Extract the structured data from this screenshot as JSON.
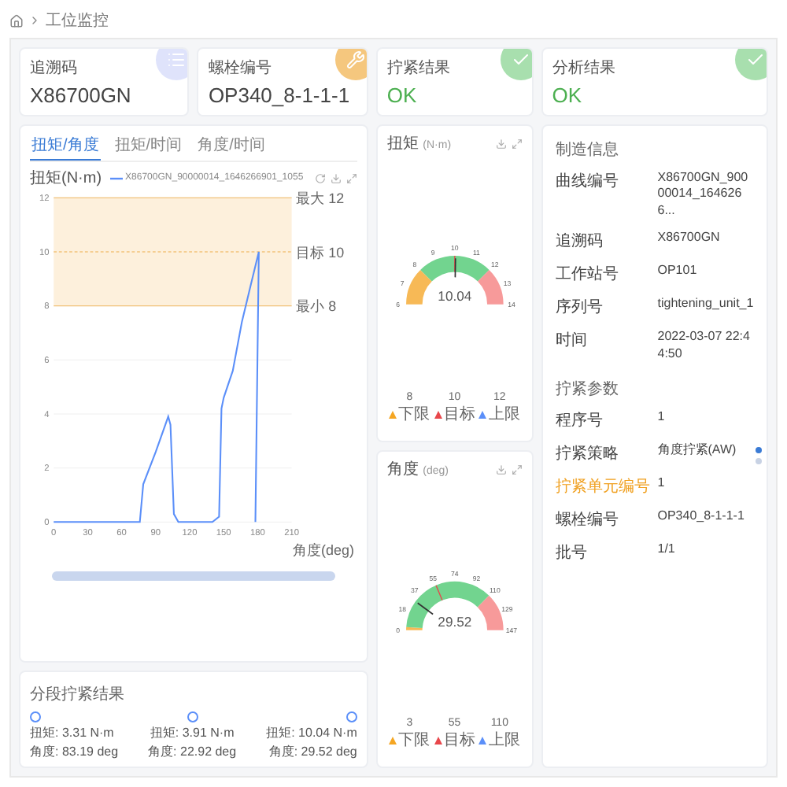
{
  "breadcrumb": {
    "items": [
      "工位监控"
    ]
  },
  "summary_cards": [
    {
      "kind": "code",
      "label": "追溯码",
      "value": "X86700GN"
    },
    {
      "kind": "bolt",
      "label": "螺栓编号",
      "value": "OP340_8-1-1-1"
    },
    {
      "kind": "ok",
      "label": "拧紧结果",
      "value": "OK"
    },
    {
      "kind": "ok",
      "label": "分析结果",
      "value": "OK"
    }
  ],
  "curve_chart": {
    "tabs": [
      {
        "label": "扭矩/角度",
        "selected": true
      },
      {
        "label": "扭矩/时间",
        "selected": false
      },
      {
        "label": "角度/时间",
        "selected": false
      }
    ],
    "chart_data": {
      "type": "line",
      "ylabel": "扭矩(N·m)",
      "xlabel": "角度(deg)",
      "x": [
        0,
        30,
        60,
        76,
        79,
        90,
        101,
        103,
        106,
        110,
        140,
        146,
        148,
        150,
        158,
        166,
        174,
        181,
        178
      ],
      "series": [
        {
          "name": "X86700GN_90000014_1646266901_1055",
          "color": "#5b8ff9",
          "values": [
            0,
            0,
            0,
            0,
            1.4,
            2.6,
            3.9,
            3.6,
            0.3,
            0,
            0,
            0.2,
            4.2,
            4.6,
            5.6,
            7.4,
            8.8,
            10,
            0
          ]
        }
      ],
      "xlim": [
        0,
        210
      ],
      "ylim": [
        0,
        12
      ],
      "xticks": [
        0,
        30,
        60,
        90,
        120,
        150,
        180,
        210
      ],
      "yticks": [
        0,
        2,
        4,
        6,
        8,
        10,
        12
      ],
      "grid": true,
      "bands": [
        {
          "axis": "y",
          "from": 8,
          "to": 12
        }
      ],
      "ref_lines": [
        {
          "axis": "y",
          "value": 12,
          "label": "最大 12"
        },
        {
          "axis": "y",
          "value": 10,
          "label": "目标 10"
        },
        {
          "axis": "y",
          "value": 8,
          "label": "最小 8"
        }
      ]
    }
  },
  "steps": {
    "title": "分段拧紧结果",
    "items": [
      {
        "torque": "扭矩: 3.31 N·m",
        "angle": "角度: 83.19 deg"
      },
      {
        "torque": "扭矩: 3.91 N·m",
        "angle": "角度: 22.92 deg"
      },
      {
        "torque": "扭矩: 10.04 N·m",
        "angle": "角度: 29.52 deg"
      }
    ]
  },
  "gauges": [
    {
      "title": "扭矩",
      "unit": "(N·m)",
      "ticks": [
        "6",
        "7",
        "8",
        "9",
        "10",
        "11",
        "12",
        "13",
        "14"
      ],
      "value": "10.04",
      "legend": [
        {
          "label": "下限",
          "value": "8",
          "color": "#f5a623"
        },
        {
          "label": "目标",
          "value": "10",
          "color": "#e8474b"
        },
        {
          "label": "上限",
          "value": "12",
          "color": "#5b8ff9"
        }
      ]
    },
    {
      "title": "角度",
      "unit": "(deg)",
      "ticks": [
        "0",
        "18",
        "37",
        "55",
        "74",
        "92",
        "110",
        "129",
        "147"
      ],
      "value": "29.52",
      "legend": [
        {
          "label": "下限",
          "value": "3",
          "color": "#f5a623"
        },
        {
          "label": "目标",
          "value": "55",
          "color": "#e8474b"
        },
        {
          "label": "上限",
          "value": "110",
          "color": "#5b8ff9"
        }
      ]
    }
  ],
  "manufacturing": {
    "title": "制造信息",
    "rows": [
      {
        "label": "曲线编号",
        "value": "X86700GN_90000014_1646266..."
      },
      {
        "label": "追溯码",
        "value": "X86700GN"
      },
      {
        "label": "工作站号",
        "value": "OP101"
      },
      {
        "label": "序列号",
        "value": "tightening_unit_1"
      },
      {
        "label": "时间",
        "value": "2022-03-07 22:44:50"
      }
    ]
  },
  "tightening_params": {
    "title": "拧紧参数",
    "rows": [
      {
        "label": "程序号",
        "value": "1",
        "highlighted": false
      },
      {
        "label": "拧紧策略",
        "value": "角度拧紧(AW)",
        "highlighted": false
      },
      {
        "label": "拧紧单元编号",
        "value": "1",
        "highlighted": true
      },
      {
        "label": "螺栓编号",
        "value": "OP340_8-1-1-1",
        "highlighted": false
      },
      {
        "label": "批号",
        "value": "1/1",
        "highlighted": false
      }
    ]
  },
  "pager": [
    {
      "selected": true
    },
    {
      "selected": false
    }
  ]
}
